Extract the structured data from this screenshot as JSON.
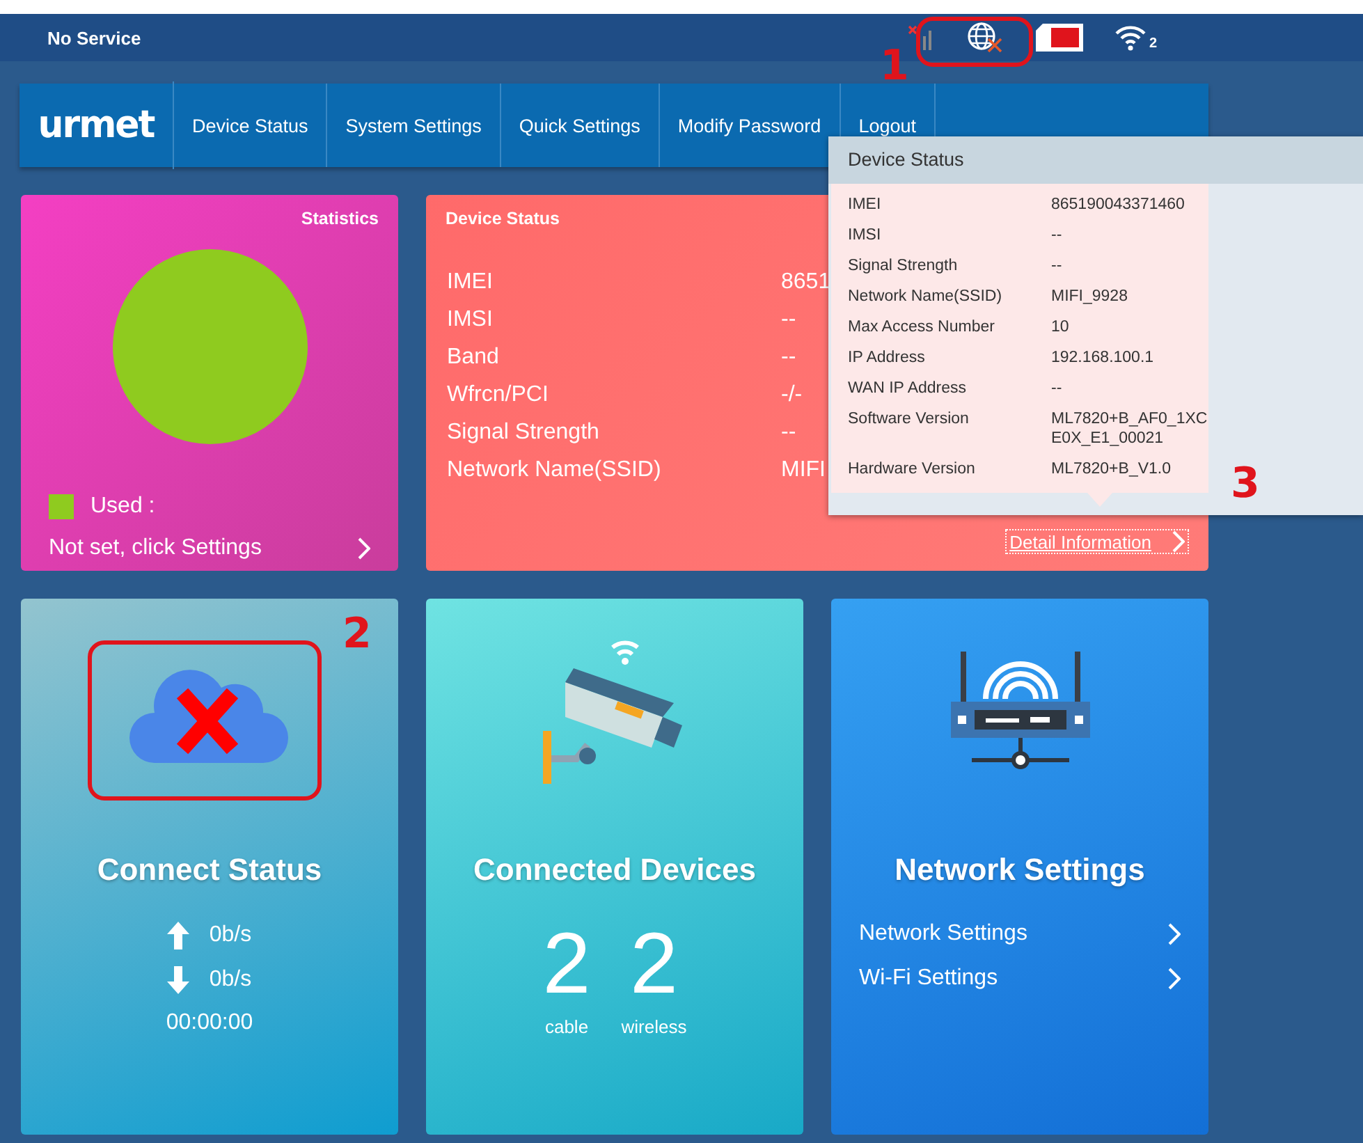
{
  "status_bar": {
    "text": "No Service",
    "wifi_clients": "2"
  },
  "nav": {
    "logo": "urmet",
    "items": [
      {
        "label": "Device Status",
        "selected": false
      },
      {
        "label": "System Settings",
        "selected": false
      },
      {
        "label": "Quick Settings",
        "selected": false
      },
      {
        "label": "Modify Password",
        "selected": false
      },
      {
        "label": "Logout",
        "selected": false
      }
    ]
  },
  "statistics": {
    "title": "Statistics",
    "legend": "Used :",
    "link": "Not set, click Settings"
  },
  "device_status": {
    "title": "Device Status",
    "rows": [
      {
        "label": "IMEI",
        "value": "8651"
      },
      {
        "label": "IMSI",
        "value": "--"
      },
      {
        "label": "Band",
        "value": "--"
      },
      {
        "label": "Wfrcn/PCI",
        "value": "-/-"
      },
      {
        "label": "Signal Strength",
        "value": "--"
      },
      {
        "label": "Network Name(SSID)",
        "value": "MIFI"
      }
    ],
    "link": "Detail Information"
  },
  "popup": {
    "title": "Device Status",
    "rows": [
      {
        "label": "IMEI",
        "value": "865190043371460"
      },
      {
        "label": "IMSI",
        "value": "--"
      },
      {
        "label": "Signal Strength",
        "value": "--"
      },
      {
        "label": "Network Name(SSID)",
        "value": "MIFI_9928"
      },
      {
        "label": "Max Access Number",
        "value": "10"
      },
      {
        "label": "IP Address",
        "value": "192.168.100.1"
      },
      {
        "label": "WAN IP Address",
        "value": "--"
      },
      {
        "label": "Software Version",
        "value": "ML7820+B_AF0_1XC E0X_E1_00021"
      },
      {
        "label": "Hardware Version",
        "value": "ML7820+B_V1.0"
      }
    ]
  },
  "connect_status": {
    "title": "Connect Status",
    "upload": "0b/s",
    "download": "0b/s",
    "duration": "00:00:00"
  },
  "connected_devices": {
    "title": "Connected Devices",
    "counts": [
      {
        "value": "2",
        "label": "cable"
      },
      {
        "value": "2",
        "label": "wireless"
      }
    ]
  },
  "network_settings": {
    "title": "Network Settings",
    "links": [
      "Network Settings",
      "Wi-Fi Settings"
    ]
  },
  "annotations": [
    "1",
    "2",
    "3"
  ]
}
